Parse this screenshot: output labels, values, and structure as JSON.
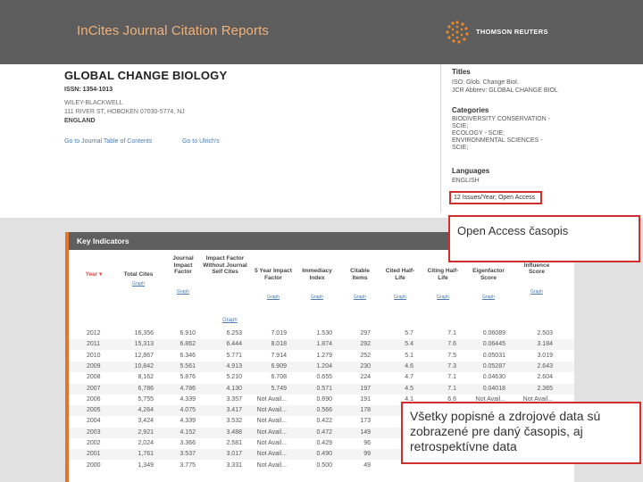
{
  "header": {
    "app_title": "InCites Journal Citation Reports",
    "brand": "THOMSON REUTERS"
  },
  "journal": {
    "title": "GLOBAL CHANGE BIOLOGY",
    "issn": "ISSN: 1354-1013",
    "publisher_line1": "WILEY-BLACKWELL",
    "publisher_line2": "111 RIVER ST, HOBOKEN 07030-5774, NJ",
    "country": "ENGLAND",
    "link_toc": "Go to Journal Table of Contents",
    "link_ulrich": "Go to Ulrich's"
  },
  "sidebar": {
    "titles_heading": "Titles",
    "titles": [
      "ISO: Glob. Change Biol.",
      "JCR Abbrev: GLOBAL CHANGE BIOL"
    ],
    "categories_heading": "Categories",
    "categories": [
      "BIODIVERSITY CONSERVATION -",
      "SCIE;",
      "ECOLOGY - SCIE;",
      "ENVIRONMENTAL SCIENCES -",
      "SCIE;"
    ],
    "languages_heading": "Languages",
    "language": "ENGLISH",
    "frequency": "12 Issues/Year; Open Access"
  },
  "key_indicators": {
    "heading": "Key Indicators",
    "columns": [
      {
        "label": "Year ▾",
        "graph": ""
      },
      {
        "label": "Total Cites",
        "graph": "Graph"
      },
      {
        "label": "Journal Impact Factor",
        "graph": "Graph"
      },
      {
        "label": "Impact Factor Without Journal Self Cites",
        "graph": ""
      },
      {
        "label": "5 Year Impact Factor",
        "graph": "Graph"
      },
      {
        "label": "Immediacy Index",
        "graph": "Graph"
      },
      {
        "label": "Citable Items",
        "graph": "Graph"
      },
      {
        "label": "Cited Half-Life",
        "graph": "Graph"
      },
      {
        "label": "Citing Half-Life",
        "graph": "Graph"
      },
      {
        "label": "Eigenfactor Score",
        "graph": "Graph"
      },
      {
        "label": "Article Influence Score",
        "graph": "Graph"
      }
    ],
    "graph_link": "Graph",
    "rows": [
      [
        "2012",
        "16,356",
        "6.910",
        "6.253",
        "7.019",
        "1.530",
        "297",
        "5.7",
        "7.1",
        "0.06089",
        "2.503"
      ],
      [
        "2011",
        "15,313",
        "6.862",
        "6.444",
        "8.018",
        "1.874",
        "292",
        "5.4",
        "7.6",
        "0.06445",
        "3.184"
      ],
      [
        "2010",
        "12,867",
        "6.346",
        "5.771",
        "7.914",
        "1.279",
        "252",
        "5.1",
        "7.5",
        "0.05031",
        "3.019"
      ],
      [
        "2009",
        "10,842",
        "5.561",
        "4.913",
        "6.909",
        "1.204",
        "230",
        "4.6",
        "7.3",
        "0.05287",
        "2.643"
      ],
      [
        "2008",
        "8,162",
        "5.876",
        "5.210",
        "6.708",
        "0.655",
        "224",
        "4.7",
        "7.1",
        "0.04630",
        "2.604"
      ],
      [
        "2007",
        "6,786",
        "4.786",
        "4.130",
        "5.749",
        "0.571",
        "197",
        "4.5",
        "7.1",
        "0.04018",
        "2.365"
      ],
      [
        "2006",
        "5,755",
        "4.339",
        "3.357",
        "Not Avail...",
        "0.690",
        "191",
        "4.1",
        "6.6",
        "Not Avail...",
        "Not Avail..."
      ],
      [
        "2005",
        "4,264",
        "4.075",
        "3.417",
        "Not Avail...",
        "0.566",
        "178",
        "",
        "",
        "",
        ""
      ],
      [
        "2004",
        "3,424",
        "4.339",
        "3.532",
        "Not Avail...",
        "0.422",
        "173",
        "",
        "",
        "",
        ""
      ],
      [
        "2003",
        "2,921",
        "4.152",
        "3.488",
        "Not Avail...",
        "0.472",
        "149",
        "",
        "",
        "",
        ""
      ],
      [
        "2002",
        "2,024",
        "3.366",
        "2.581",
        "Not Avail...",
        "0.429",
        "96",
        "",
        "",
        "",
        ""
      ],
      [
        "2001",
        "1,761",
        "3.537",
        "3.017",
        "Not Avail...",
        "0.490",
        "99",
        "",
        "",
        "",
        ""
      ],
      [
        "2000",
        "1,349",
        "3.775",
        "3.331",
        "Not Avail...",
        "0.500",
        "49",
        "",
        "",
        "",
        ""
      ]
    ]
  },
  "callouts": {
    "open_access": "Open Access časopis",
    "description": "Všetky popisné a zdrojové data sú zobrazené pre daný časopis, aj retrospektívne data"
  },
  "colors": {
    "header_bg": "#5d5d5d",
    "title_orange": "#f2b27a",
    "accent_red": "#d32e2e",
    "accent_orange": "#e2762d",
    "link_blue": "#4a7ab2"
  }
}
